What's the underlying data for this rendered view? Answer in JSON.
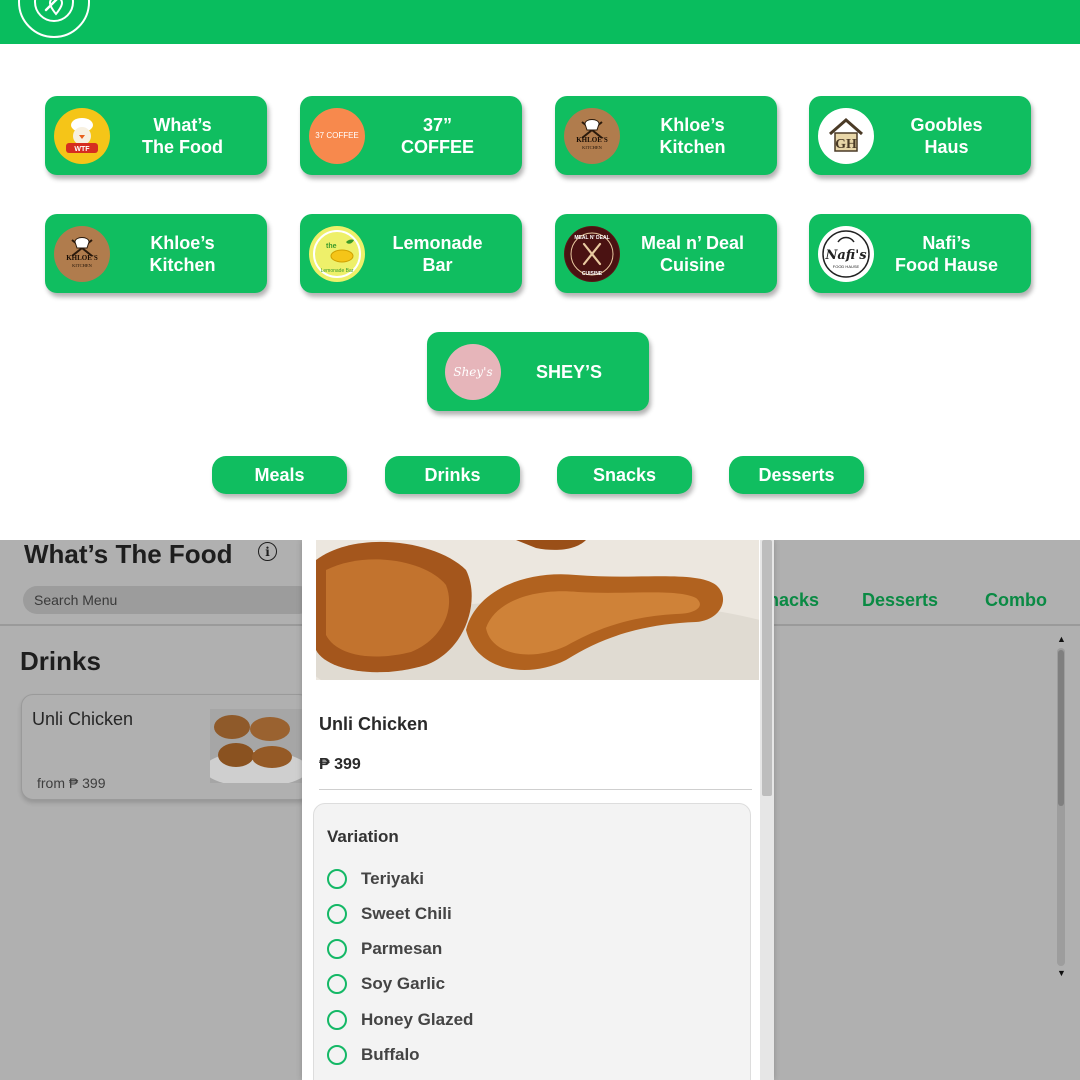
{
  "header": {
    "logo_icon": "fork-in-location-pin-icon",
    "brand_color": "#09bd5e"
  },
  "stores": [
    {
      "name": "What’s\nThe Food",
      "logo_icon": "chef-rooster-logo"
    },
    {
      "name": "37”\nCOFFEE",
      "logo_text": "37 COFFEE",
      "logo_color": "#f7894d"
    },
    {
      "name": "Khloe’s\nKitchen",
      "logo_text": "KHLOE'S KITCHEN"
    },
    {
      "name": "Goobles\nHaus",
      "logo_text": "GH"
    },
    {
      "name": "Khloe’s\nKitchen",
      "logo_text": "KHLOE'S KITCHEN"
    },
    {
      "name": "Lemonade\nBar",
      "logo_text": "the Lemonade Bar"
    },
    {
      "name": "Meal n’ Deal\nCuisine",
      "logo_text": "MEAL N' DEAL CUISINE"
    },
    {
      "name": "Nafi’s\nFood Hause",
      "logo_text": "Nafi's"
    },
    {
      "name": "SHEY’S",
      "logo_text": "Shey's",
      "logo_color": "#e7b7bc"
    }
  ],
  "categories": [
    "Meals",
    "Drinks",
    "Snacks",
    "Desserts"
  ],
  "app": {
    "title": "What’s The Food",
    "info_icon": "info-icon",
    "search_placeholder": "Search Menu",
    "tabs": [
      "nacks",
      "Desserts",
      "Combo"
    ],
    "section_title": "Drinks",
    "menu_item": {
      "name": "Unli Chicken",
      "price": "from ₱ 399"
    }
  },
  "modal": {
    "title": "Unli Chicken",
    "price": "₱ 399",
    "variation_title": "Variation",
    "options": [
      "Teriyaki",
      "Sweet Chili",
      "Parmesan",
      "Soy Garlic",
      "Honey Glazed",
      "Buffalo"
    ]
  }
}
